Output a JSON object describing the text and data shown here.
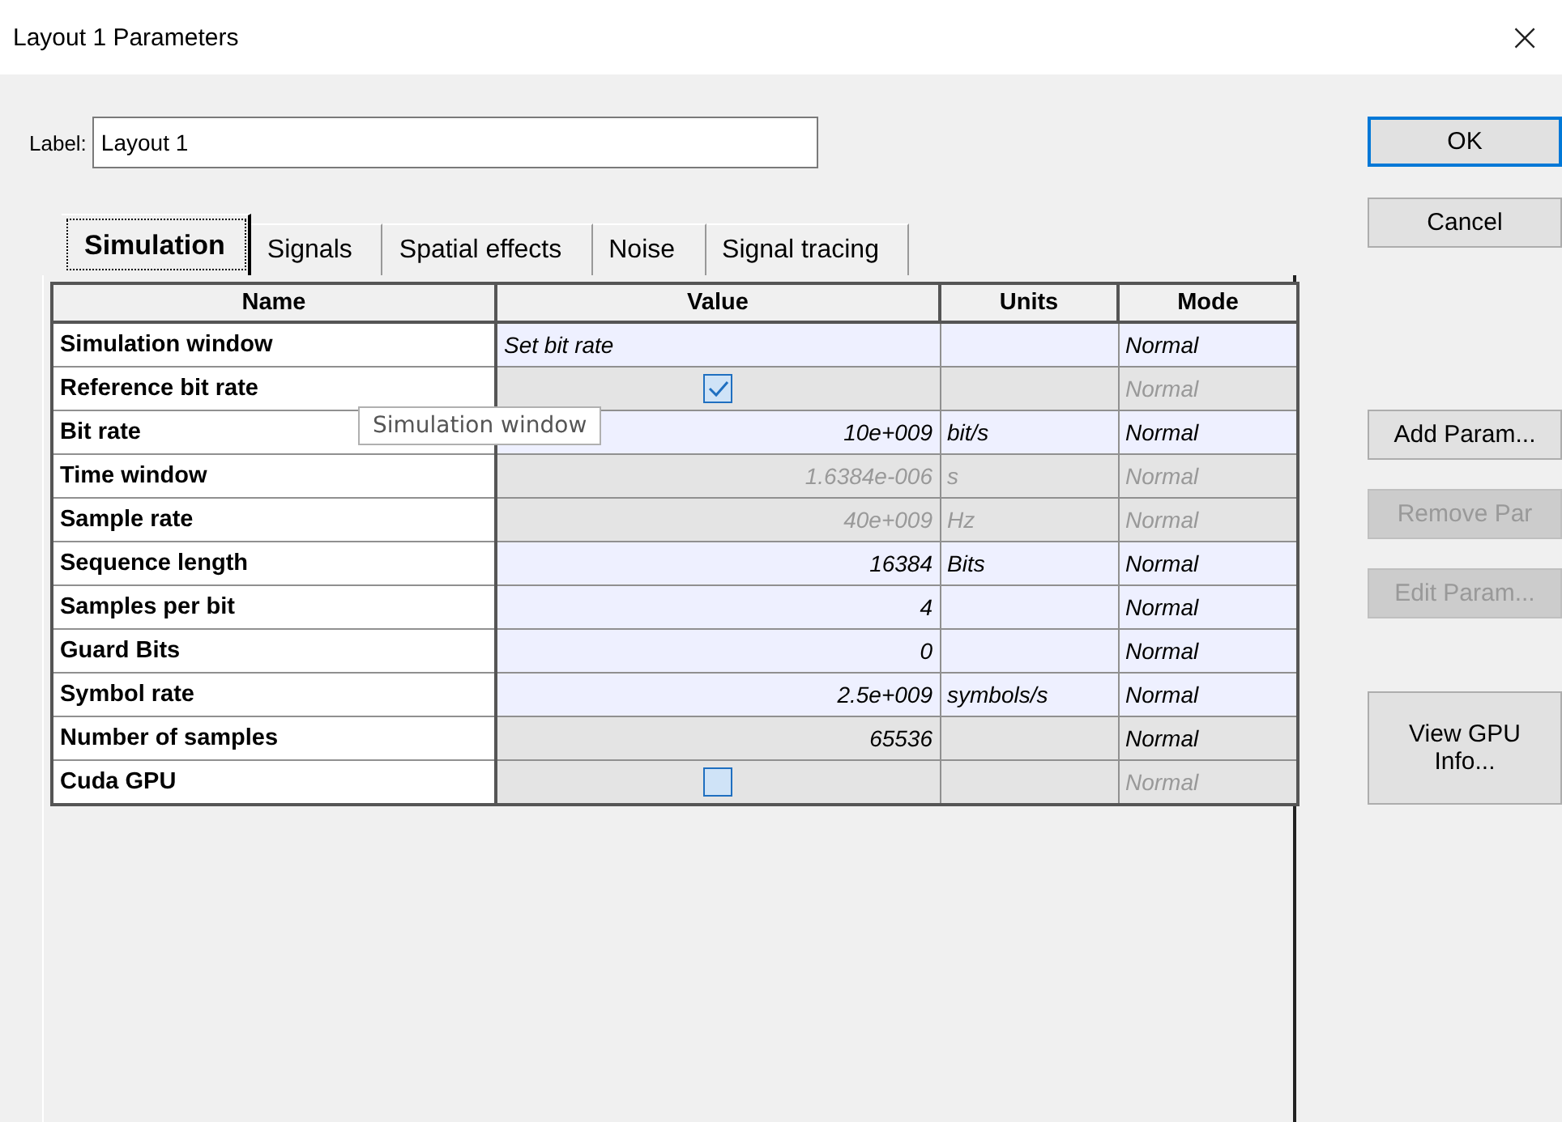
{
  "window": {
    "title": "Layout 1 Parameters",
    "close": "×"
  },
  "label": {
    "caption": "Label:",
    "value": "Layout 1"
  },
  "tabs": [
    {
      "label": "Simulation",
      "selected": true
    },
    {
      "label": "Signals",
      "selected": false
    },
    {
      "label": "Spatial effects",
      "selected": false
    },
    {
      "label": "Noise",
      "selected": false
    },
    {
      "label": "Signal tracing",
      "selected": false
    }
  ],
  "table": {
    "columns": [
      "Name",
      "Value",
      "Units",
      "Mode"
    ],
    "rows": [
      {
        "name": "Simulation window",
        "kind": "text",
        "value": "Set bit rate",
        "units": "",
        "mode": "Normal",
        "editable": true,
        "disabled": false
      },
      {
        "name": "Reference bit rate",
        "kind": "checkbox",
        "checked": true,
        "units": "",
        "mode": "Normal",
        "editable": false,
        "disabled": true
      },
      {
        "name": "Bit rate",
        "kind": "number",
        "value": "10e+009",
        "units": "bit/s",
        "mode": "Normal",
        "editable": true,
        "disabled": false
      },
      {
        "name": "Time window",
        "kind": "number",
        "value": "1.6384e-006",
        "units": "s",
        "mode": "Normal",
        "editable": false,
        "disabled": true
      },
      {
        "name": "Sample rate",
        "kind": "number",
        "value": "40e+009",
        "units": "Hz",
        "mode": "Normal",
        "editable": false,
        "disabled": true
      },
      {
        "name": "Sequence length",
        "kind": "number",
        "value": "16384",
        "units": "Bits",
        "mode": "Normal",
        "editable": true,
        "disabled": false
      },
      {
        "name": "Samples per bit",
        "kind": "number",
        "value": "4",
        "units": "",
        "mode": "Normal",
        "editable": true,
        "disabled": false
      },
      {
        "name": "Guard Bits",
        "kind": "number",
        "value": "0",
        "units": "",
        "mode": "Normal",
        "editable": true,
        "disabled": false
      },
      {
        "name": "Symbol rate",
        "kind": "number",
        "value": "2.5e+009",
        "units": "symbols/s",
        "mode": "Normal",
        "editable": true,
        "disabled": false
      },
      {
        "name": "Number of samples",
        "kind": "number",
        "value": "65536",
        "units": "",
        "mode": "Normal",
        "editable": false,
        "disabled": false
      },
      {
        "name": "Cuda GPU",
        "kind": "checkbox",
        "checked": false,
        "units": "",
        "mode": "Normal",
        "editable": false,
        "disabled": true
      }
    ]
  },
  "tooltip": "Simulation window",
  "buttons": [
    {
      "label": "OK",
      "default": true,
      "disabled": false
    },
    {
      "label": "Cancel",
      "default": false,
      "disabled": false
    },
    {
      "label": "Add Param...",
      "default": false,
      "disabled": false
    },
    {
      "label": "Remove Par",
      "default": false,
      "disabled": true
    },
    {
      "label": "Edit Param...",
      "default": false,
      "disabled": true
    },
    {
      "label": "View GPU Info...",
      "default": false,
      "disabled": false
    }
  ]
}
